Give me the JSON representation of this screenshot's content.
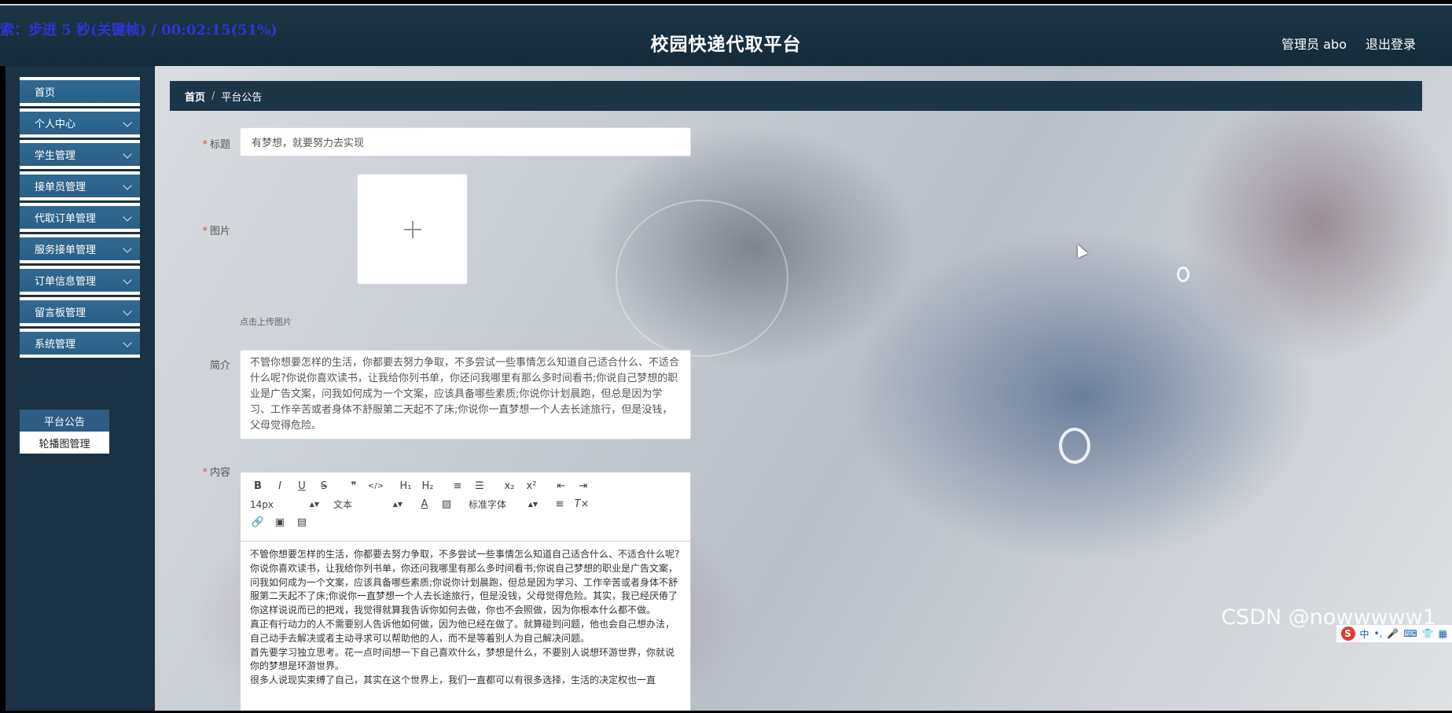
{
  "overlay": {
    "text": "索：步进 5 秒(关键帧) / 00:02:15(51%)"
  },
  "header": {
    "title": "校园快递代取平台",
    "admin_label": "管理员 abo",
    "logout_label": "退出登录"
  },
  "sidebar": {
    "items": [
      {
        "label": "首页",
        "has_arrow": false
      },
      {
        "label": "个人中心",
        "has_arrow": true
      },
      {
        "label": "学生管理",
        "has_arrow": true
      },
      {
        "label": "接单员管理",
        "has_arrow": true
      },
      {
        "label": "代取订单管理",
        "has_arrow": true
      },
      {
        "label": "服务接单管理",
        "has_arrow": true
      },
      {
        "label": "订单信息管理",
        "has_arrow": true
      },
      {
        "label": "留言板管理",
        "has_arrow": true
      },
      {
        "label": "系统管理",
        "has_arrow": true
      }
    ],
    "submenu": [
      {
        "label": "平台公告",
        "active": true
      },
      {
        "label": "轮播图管理",
        "active": false
      }
    ]
  },
  "breadcrumb": {
    "home": "首页",
    "separator": "/",
    "current": "平台公告"
  },
  "form": {
    "title_label": "标题",
    "title_value": "有梦想，就要努力去实现",
    "image_label": "图片",
    "upload_tip": "点击上传图片",
    "intro_label": "简介",
    "intro_value": "不管你想要怎样的生活，你都要去努力争取，不多尝试一些事情怎么知道自己适合什么、不适合什么呢?你说你喜欢读书，让我给你列书单，你还问我哪里有那么多时间看书;你说自己梦想的职业是广告文案，问我如何成为一个文案，应该具备哪些素质;你说你计划晨跑，但总是因为学习、工作辛苦或者身体不舒服第二天起不了床;你说你一直梦想一个人去长途旅行，但是没钱，父母觉得危险。",
    "content_label": "内容"
  },
  "editor": {
    "toolbar_row1": [
      "B",
      "I",
      "U",
      "S",
      "❞",
      "</>",
      "H₁",
      "H₂",
      "≡",
      "☰",
      "x₂",
      "x²",
      "⇤",
      "⇥"
    ],
    "font_size": "14px",
    "text_type": "文本",
    "font_family": "标准字体",
    "content": [
      "不管你想要怎样的生活，你都要去努力争取，不多尝试一些事情怎么知道自己适合什么、不适合什么呢?",
      "你说你喜欢读书，让我给你列书单，你还问我哪里有那么多时间看书;你说自己梦想的职业是广告文案，问我如何成为一个文案，应该具备哪些素质;你说你计划晨跑，但总是因为学习、工作辛苦或者身体不舒服第二天起不了床;你说你一直梦想一个人去长途旅行，但是没钱，父母觉得危险。其实，我已经厌倦了你这样说说而已的把戏，我觉得就算我告诉你如何去做，你也不会照做，因为你根本什么都不做。",
      "真正有行动力的人不需要别人告诉他如何做，因为他已经在做了。就算碰到问题，他也会自己想办法，自己动手去解决或者主动寻求可以帮助他的人，而不是等着别人为自己解决问题。",
      "首先要学习独立思考。花一点时间想一下自己喜欢什么，梦想是什么，不要别人说想环游世界，你就说你的梦想是环游世界。",
      "很多人说现实束缚了自己，其实在这个世界上，我们一直都可以有很多选择，生活的决定权也一直"
    ]
  },
  "watermark": "CSDN @nowwwww1",
  "ime": {
    "label": "中"
  }
}
